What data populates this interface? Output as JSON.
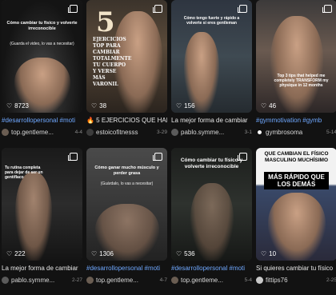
{
  "cards": [
    {
      "overlay": "Cómo cambiar tu físico y volverte irreconocible",
      "overlay_sub": "(Guarda el video, lo vas a necesitar)",
      "likes": "8723",
      "title": "#desarrollopersonal #moti",
      "author": "top.gentleme...",
      "date": "4-4"
    },
    {
      "overlay": "5",
      "overlay_sub": "EJERCICIOS TOP PARA CAMBIAR TOTALMENTE TU CUERPO Y VERSE MÁS VARONIL",
      "likes": "38",
      "title": "🔥 5 EJERCICIOS QUE HAR",
      "author": "estoicofitnesss",
      "date": "3-29"
    },
    {
      "overlay": "Cómo tengo fuerte y rápido a volverte si eres gentleman",
      "overlay_sub": "",
      "likes": "156",
      "title": "La mejor forma de cambiar",
      "author": "pablo.symme...",
      "date": "3-1"
    },
    {
      "overlay": "Top 3 tips that helped me completely TRANSFORM my physique in 12 months",
      "overlay_sub": "",
      "likes": "46",
      "title": "#gymmotivation #gymb",
      "author": "gymbrosoma",
      "date": "5-14"
    },
    {
      "overlay": "Tu rutina completa para dejar de ser un gentiflaco",
      "overlay_sub": "",
      "likes": "222",
      "title": "La mejor forma de cambiar",
      "author": "pablo.symme...",
      "date": "2-27"
    },
    {
      "overlay": "Cómo ganar mucho músculo y perder grasa",
      "overlay_sub": "(Guárdalo, lo vas a necesitar)",
      "likes": "1306",
      "title": "#desarrollopersonal #moti",
      "author": "top.gentleme...",
      "date": "4-7"
    },
    {
      "overlay": "Cómo cambiar tu físico y volverte irreconocible",
      "overlay_sub": "",
      "likes": "536",
      "title": "#desarrollopersonal #moti",
      "author": "top.gentleme...",
      "date": "5-4"
    },
    {
      "overlay": "QUE CAMBIAN EL FÍSICO MASCULINO MUCHÍSIMO",
      "overlay_sub": "MÁS RÁPIDO QUE LOS DEMÁS",
      "likes": "10",
      "title": "Si quieres cambiar tu físico",
      "author": "fittips76",
      "date": "2-25"
    }
  ],
  "colors": {
    "background": "#121212",
    "hashtag": "#6fa8ff",
    "meta_date": "#8a8a8a"
  },
  "icons": {
    "likes": "heart-outline-icon",
    "multi": "multi-image-icon"
  }
}
